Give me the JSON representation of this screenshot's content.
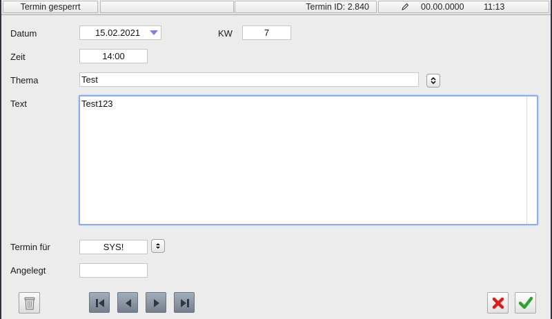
{
  "statusbar": {
    "locked": "Termin gesperrt",
    "id_text": "Termin ID: 2.840",
    "edit_date": "00.00.0000",
    "edit_time": "11:13"
  },
  "form": {
    "datum": {
      "label": "Datum",
      "value": "15.02.2021"
    },
    "kw": {
      "label": "KW",
      "value": "7"
    },
    "zeit": {
      "label": "Zeit",
      "value": "14:00"
    },
    "thema": {
      "label": "Thema",
      "value": "Test"
    },
    "text": {
      "label": "Text",
      "value": "Test123"
    },
    "termin_fuer": {
      "label": "Termin für",
      "value": "SYS!"
    },
    "angelegt": {
      "label": "Angelegt",
      "value": ""
    }
  },
  "icons": {
    "status_edit": "pencil-icon",
    "date_dropdown": "triangle-down-icon",
    "stepper": "up-down-arrows-icon",
    "delete": "trash-icon",
    "first": "skip-first-icon",
    "previous": "previous-icon",
    "next": "next-icon",
    "last": "skip-last-icon",
    "cancel": "red-x-icon",
    "confirm": "green-check-icon"
  },
  "colors": {
    "focus_border": "#8aaeea",
    "dropdown_arrow": "#7b7fe6",
    "cancel_red": "#d81e1e",
    "confirm_green": "#2ea42e",
    "nav_button": "#8a95a2"
  }
}
